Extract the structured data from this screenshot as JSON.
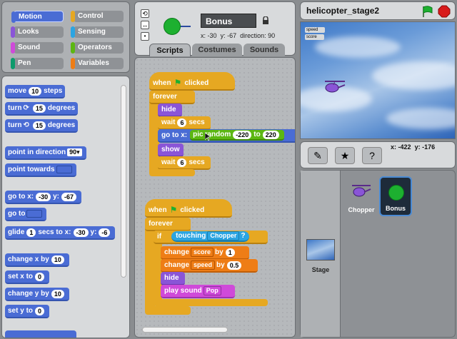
{
  "categories": [
    {
      "label": "Motion",
      "color": "#4a6cd4",
      "active": true
    },
    {
      "label": "Control",
      "color": "#e6a822"
    },
    {
      "label": "Looks",
      "color": "#8a55d7"
    },
    {
      "label": "Sensing",
      "color": "#2ca5e2"
    },
    {
      "label": "Sound",
      "color": "#cf4ad9"
    },
    {
      "label": "Operators",
      "color": "#5cb712"
    },
    {
      "label": "Pen",
      "color": "#0e9a6c"
    },
    {
      "label": "Variables",
      "color": "#ee7d16"
    }
  ],
  "palette": {
    "move": {
      "pre": "move",
      "val": "10",
      "post": "steps"
    },
    "turn_cw": {
      "pre": "turn",
      "icon": "⟳",
      "val": "15",
      "post": "degrees"
    },
    "turn_ccw": {
      "pre": "turn",
      "icon": "⟲",
      "val": "15",
      "post": "degrees"
    },
    "point_dir": {
      "pre": "point in direction",
      "val": "90▾"
    },
    "point_towards": {
      "pre": "point towards"
    },
    "goto_xy": {
      "pre": "go to x:",
      "x": "-30",
      "ylbl": "y:",
      "y": "-67"
    },
    "goto": {
      "pre": "go to"
    },
    "glide": {
      "pre": "glide",
      "secs": "1",
      "mid": "secs to x:",
      "x": "-30",
      "ylbl": "y:",
      "y": "-6"
    },
    "change_x": {
      "pre": "change x by",
      "val": "10"
    },
    "set_x": {
      "pre": "set x to",
      "val": "0"
    },
    "change_y": {
      "pre": "change y by",
      "val": "10"
    },
    "set_y": {
      "pre": "set y to",
      "val": "0"
    }
  },
  "sprite": {
    "name": "Bonus",
    "x_label": "x:",
    "x": "-30",
    "y_label": "y:",
    "y": "-67",
    "direction_label": "direction:",
    "direction": "90"
  },
  "tabs": [
    "Scripts",
    "Costumes",
    "Sounds"
  ],
  "script1": {
    "hat": "when",
    "hat_post": "clicked",
    "forever": "forever",
    "hide": "hide",
    "wait1": {
      "pre": "wait",
      "val": "6",
      "post": "secs"
    },
    "goto": {
      "pre": "go to x:",
      "pick": "pic",
      "random": "random",
      "from": "-220",
      "to": "to",
      "to_val": "220"
    },
    "show": "show",
    "wait2": {
      "pre": "wait",
      "val": "6",
      "post": "secs"
    }
  },
  "script2": {
    "hat": "when",
    "hat_post": "clicked",
    "forever": "forever",
    "if": "if",
    "touching": "touching",
    "touching_target": "Chopper",
    "q": "?",
    "change1": {
      "pre": "change",
      "var": "score",
      "by": "by",
      "val": "1"
    },
    "change2": {
      "pre": "change",
      "var": "speed",
      "by": "by",
      "val": "0.5"
    },
    "hide": "hide",
    "play": {
      "pre": "play sound",
      "val": "Pop"
    }
  },
  "stage": {
    "title": "helicopter_stage2",
    "monitors": [
      {
        "label": "speed",
        "value": ""
      },
      {
        "label": "score",
        "value": ""
      }
    ],
    "mouse_x_label": "x:",
    "mouse_x": "-422",
    "mouse_y_label": "y:",
    "mouse_y": "-176"
  },
  "sprites": [
    {
      "name": "Chopper"
    },
    {
      "name": "Bonus",
      "selected": true
    }
  ],
  "stage_label": "Stage",
  "icons": {
    "green_flag": "green-flag-icon",
    "stop": "stop-icon",
    "lock": "lock-icon"
  }
}
